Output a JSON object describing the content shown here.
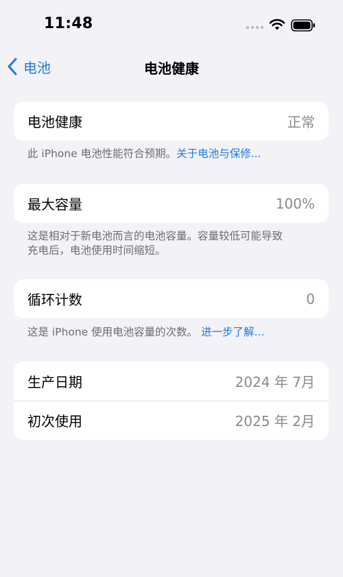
{
  "status_bar": {
    "time": "11:48"
  },
  "nav": {
    "back_label": "电池",
    "title": "电池健康"
  },
  "health": {
    "label": "电池健康",
    "value": "正常",
    "note": "此 iPhone 电池性能符合预期。",
    "note_link": "关于电池与保修..."
  },
  "capacity": {
    "label": "最大容量",
    "value": "100%",
    "note_line1": "这是相对于新电池而言的电池容量。容量较低可能导致",
    "note_line2": "充电后，电池使用时间缩短。"
  },
  "cycles": {
    "label": "循环计数",
    "value": "0",
    "note": "这是 iPhone 使用电池容量的次数。",
    "note_link": "进一步了解..."
  },
  "dates": {
    "manufacture_label": "生产日期",
    "manufacture_value": "2024 年 7月",
    "first_use_label": "初次使用",
    "first_use_value": "2025 年 2月"
  },
  "colors": {
    "accent": "#1f7bd6",
    "background": "#f2f2f7",
    "card": "#ffffff",
    "secondary_text": "#8a8a8e"
  }
}
